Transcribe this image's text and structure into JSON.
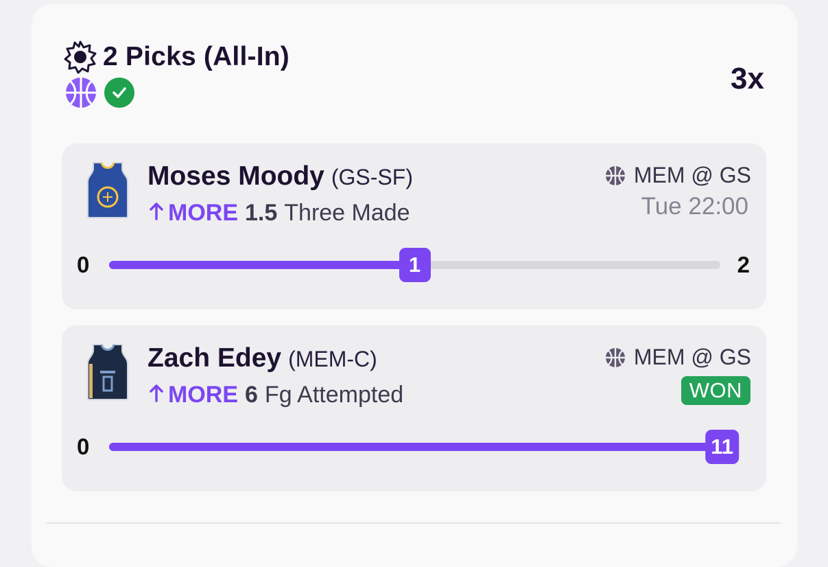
{
  "entry": {
    "title": "2 Picks (All-In)",
    "multiplier": "3x",
    "icons": [
      "sun-icon",
      "basketball-icon",
      "check-icon"
    ],
    "accent_color": "#7b46f2",
    "success_color": "#1fa14d"
  },
  "picks": [
    {
      "player_name": "Moses Moody",
      "team_position": "(GS-SF)",
      "direction": "MORE",
      "line": "1.5",
      "stat": "Three Made",
      "matchup": "MEM @ GS",
      "game_time": "Tue 22:00",
      "progress": {
        "min": "0",
        "max": "2",
        "current": "1",
        "fraction": 0.5
      },
      "jersey_icon": "warriors-jersey-icon"
    },
    {
      "player_name": "Zach Edey",
      "team_position": "(MEM-C)",
      "direction": "MORE",
      "line": "6",
      "stat": "Fg Attempted",
      "matchup": "MEM @ GS",
      "status": "WON",
      "progress": {
        "min": "0",
        "current": "11",
        "fraction": 1.0
      },
      "jersey_icon": "grizzlies-jersey-icon"
    }
  ]
}
